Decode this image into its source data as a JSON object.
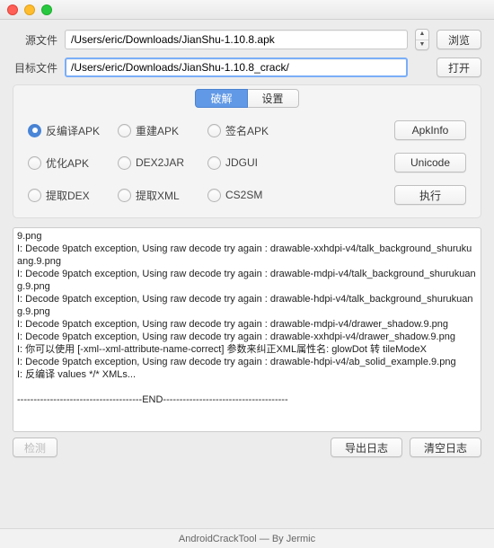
{
  "labels": {
    "source": "源文件",
    "target": "目标文件"
  },
  "fields": {
    "source": "/Users/eric/Downloads/JianShu-1.10.8.apk",
    "target": "/Users/eric/Downloads/JianShu-1.10.8_crack/"
  },
  "buttons": {
    "browse": "浏览",
    "open": "打开",
    "apkinfo": "ApkInfo",
    "unicode": "Unicode",
    "execute": "执行",
    "detect": "检测",
    "exportlog": "导出日志",
    "clearlog": "清空日志"
  },
  "tabs": {
    "crack": "破解",
    "settings": "设置"
  },
  "options": {
    "decompile": "反编译APK",
    "rebuild": "重建APK",
    "sign": "签名APK",
    "optimize": "优化APK",
    "dex2jar": "DEX2JAR",
    "jdgui": "JDGUI",
    "extractdex": "提取DEX",
    "extractxml": "提取XML",
    "cs2sm": "CS2SM"
  },
  "log": "9.png\nI: Decode 9patch exception, Using raw decode try again : drawable-xxhdpi-v4/talk_background_shurukuang.9.png\nI: Decode 9patch exception, Using raw decode try again : drawable-mdpi-v4/talk_background_shurukuang.9.png\nI: Decode 9patch exception, Using raw decode try again : drawable-hdpi-v4/talk_background_shurukuang.9.png\nI: Decode 9patch exception, Using raw decode try again : drawable-mdpi-v4/drawer_shadow.9.png\nI: Decode 9patch exception, Using raw decode try again : drawable-xxhdpi-v4/drawer_shadow.9.png\nI: 你可以使用 [-xml--xml-attribute-name-correct] 参数来纠正XML属性名: glowDot 转 tileModeX\nI: Decode 9patch exception, Using raw decode try again : drawable-hdpi-v4/ab_solid_example.9.png\nI: 反编译 values */* XMLs...\n\n--------------------------------------END--------------------------------------",
  "footer": "AndroidCrackTool   —  By  Jermic"
}
